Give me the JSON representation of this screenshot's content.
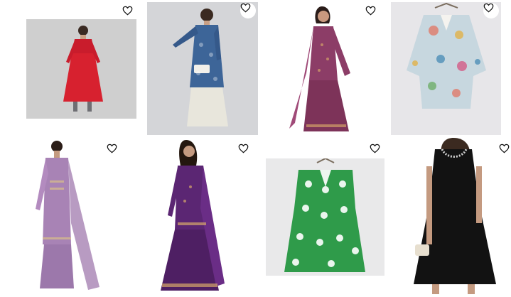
{
  "products": [
    {
      "name": "red-anarkali-kurta",
      "icon": "heart-outline-icon",
      "bg": "#cfcfcf",
      "dress": "#d7212f"
    },
    {
      "name": "blue-printed-kurta-set",
      "icon": "heart-outline-icon",
      "bg": "#d4d5d8",
      "dress": "#3d6598"
    },
    {
      "name": "mauve-sharara-suit",
      "icon": "heart-outline-icon",
      "bg": "#ffffff",
      "dress": "#8c3d67"
    },
    {
      "name": "floral-print-top",
      "icon": "heart-outline-icon",
      "bg": "#e7e6e9",
      "dress": "#c7d7df"
    },
    {
      "name": "lavender-palazzo-suit",
      "icon": "heart-outline-icon",
      "bg": "#ffffff",
      "dress": "#a883b5"
    },
    {
      "name": "purple-lehenga-suit",
      "icon": "heart-outline-icon",
      "bg": "#ffffff",
      "dress": "#5b2673"
    },
    {
      "name": "green-print-tunic",
      "icon": "heart-outline-icon",
      "bg": "#e9e9ea",
      "dress": "#2f9b4a"
    },
    {
      "name": "black-sleeveless-dress",
      "icon": "heart-outline-icon",
      "bg": "#ffffff",
      "dress": "#121212"
    }
  ]
}
